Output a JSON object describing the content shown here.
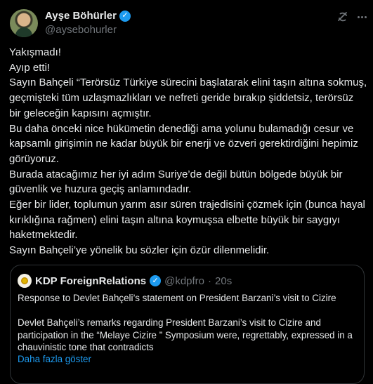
{
  "author": {
    "display_name": "Ayşe Böhürler",
    "handle": "@aysebohurler",
    "verified_icon": "verified-badge-icon"
  },
  "header_icons": [
    "grok-icon",
    "more-options-icon"
  ],
  "tweet": {
    "lines": [
      "Yakışmadı!",
      "Ayıp etti!",
      "Sayın Bahçeli “Terörsüz Türkiye sürecini başlatarak elini taşın altına sokmuş, geçmişteki tüm uzlaşmazlıkları ve nefreti geride bırakıp şiddetsiz, terörsüz bir geleceğin kapısını açmıştır.",
      "Bu daha önceki nice hükümetin denediği ama yolunu bulamadığı cesur ve kapsamlı girişimin ne kadar büyük bir enerji ve özveri gerektirdiğini hepimiz görüyoruz.",
      "Burada atacağımız her iyi adım Suriye’de değil bütün bölgede büyük bir güvenlik ve huzura geçiş anlamındadır.",
      "Eğer bir lider, toplumun yarım asır süren trajedisini çözmek için (bunca hayal kırıklığına rağmen) elini taşın altına koymuşsa elbette büyük bir saygıyı haketmektedir.",
      "Sayın Bahçeli’ye yönelik bu sözler için özür dilenmelidir."
    ]
  },
  "quote": {
    "display_name": "KDP ForeignRelations",
    "handle": "@kdpfro",
    "separator": "·",
    "time": "20s",
    "title": "Response to Devlet Bahçeli’s  statement on President Barzani’s visit to Cizire",
    "body": "Devlet Bahçeli’s remarks regarding President Barzani’s visit to Cizire and participation in the “Melaye Cizire ” Symposium were, regrettably, expressed in a chauvinistic tone that contradicts",
    "show_more": "Daha fazla göster"
  },
  "colors": {
    "background": "#000000",
    "text": "#e7e9ea",
    "muted": "#71767b",
    "accent": "#1d9bf0",
    "border": "#2f3336"
  }
}
